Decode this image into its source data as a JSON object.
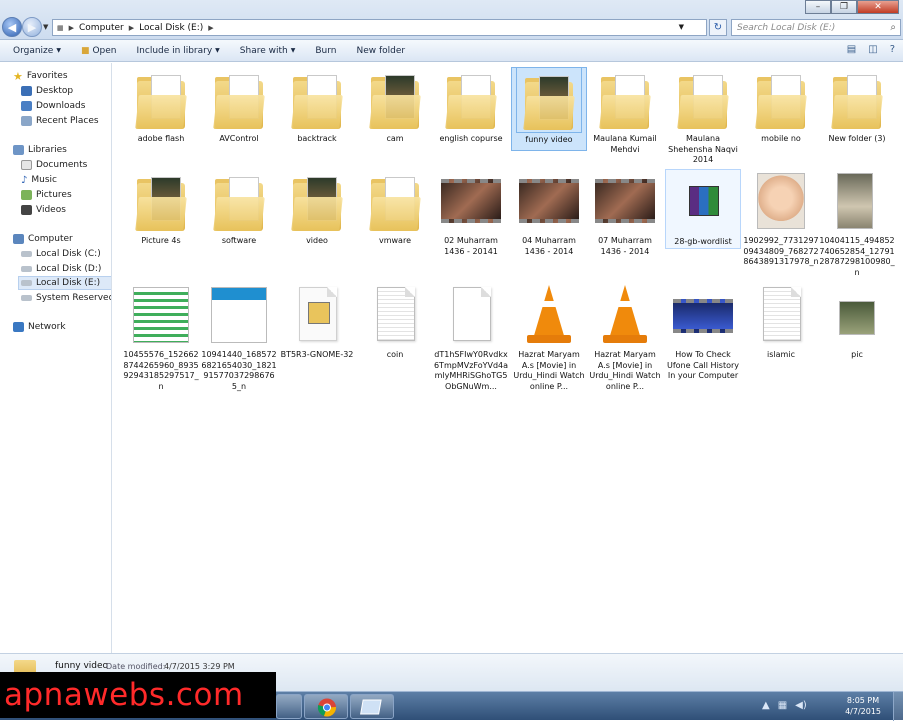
{
  "address": {
    "crumbs": [
      "Computer",
      "Local Disk (E:)"
    ]
  },
  "search": {
    "placeholder": "Search Local Disk (E:)"
  },
  "toolbar": {
    "organize": "Organize",
    "open": "Open",
    "include": "Include in library",
    "share": "Share with",
    "burn": "Burn",
    "new_folder": "New folder"
  },
  "nav": {
    "favorites": "Favorites",
    "desktop": "Desktop",
    "downloads": "Downloads",
    "recent": "Recent Places",
    "libraries": "Libraries",
    "documents": "Documents",
    "music": "Music",
    "pictures": "Pictures",
    "videos": "Videos",
    "computer": "Computer",
    "disk_c": "Local Disk (C:)",
    "disk_d": "Local Disk (D:)",
    "disk_e": "Local Disk (E:)",
    "system_reserved": "System Reserved (H:",
    "network": "Network"
  },
  "items": [
    {
      "label": "adobe flash",
      "kind": "folder"
    },
    {
      "label": "AVControl",
      "kind": "folder"
    },
    {
      "label": "backtrack",
      "kind": "folder"
    },
    {
      "label": "cam",
      "kind": "folder-media"
    },
    {
      "label": "english copurse",
      "kind": "folder"
    },
    {
      "label": "funny video",
      "kind": "folder-media",
      "selected": true
    },
    {
      "label": "Maulana Kumail Mehdvi",
      "kind": "folder"
    },
    {
      "label": "Maulana Shehensha Naqvi 2014",
      "kind": "folder"
    },
    {
      "label": "mobile no",
      "kind": "folder"
    },
    {
      "label": "New folder (3)",
      "kind": "folder"
    },
    {
      "label": "Picture 4s",
      "kind": "folder-media"
    },
    {
      "label": "software",
      "kind": "folder"
    },
    {
      "label": "video",
      "kind": "folder-media"
    },
    {
      "label": "vmware",
      "kind": "folder"
    },
    {
      "label": "02 Muharram 1436 - 20141",
      "kind": "video"
    },
    {
      "label": "04 Muharram 1436 - 2014",
      "kind": "video"
    },
    {
      "label": "07 Muharram 1436 - 2014",
      "kind": "video"
    },
    {
      "label": "28-gb-wordlist",
      "kind": "rar",
      "hover": true
    },
    {
      "label": "1902992_773129709434809_7682728643891317978_n",
      "kind": "image-baby"
    },
    {
      "label": "10404115_494852740652854_1279128787298100980_n",
      "kind": "image-cat"
    },
    {
      "label": "10455576_1526628744265960_893592943185297517_n",
      "kind": "image-table"
    },
    {
      "label": "10941440_1685726821654030_1821915770372986765_n",
      "kind": "image-text"
    },
    {
      "label": "BT5R3-GNOME-32",
      "kind": "iso"
    },
    {
      "label": "coin",
      "kind": "doc"
    },
    {
      "label": "dT1hSFIwY0Rvdkx6TmpMVzFoYVd4amlyMHRiSGhoTG5ObGNuWm...",
      "kind": "doc-white"
    },
    {
      "label": "Hazrat Maryam A.s [Movie] in Urdu_Hindi Watch online P...",
      "kind": "vlc"
    },
    {
      "label": "Hazrat Maryam A.s [Movie] in Urdu_Hindi Watch online P...",
      "kind": "vlc"
    },
    {
      "label": "How To Check Ufone Call History In your Computer",
      "kind": "video-small"
    },
    {
      "label": "islamic",
      "kind": "doc"
    },
    {
      "label": "pic",
      "kind": "image-small"
    }
  ],
  "details": {
    "name": "funny video",
    "modified_label": "Date modified:",
    "modified_value": "4/7/2015 3:29 PM"
  },
  "clock": {
    "time": "8:05 PM",
    "date": "4/7/2015"
  },
  "watermark": "apnawebs.com"
}
